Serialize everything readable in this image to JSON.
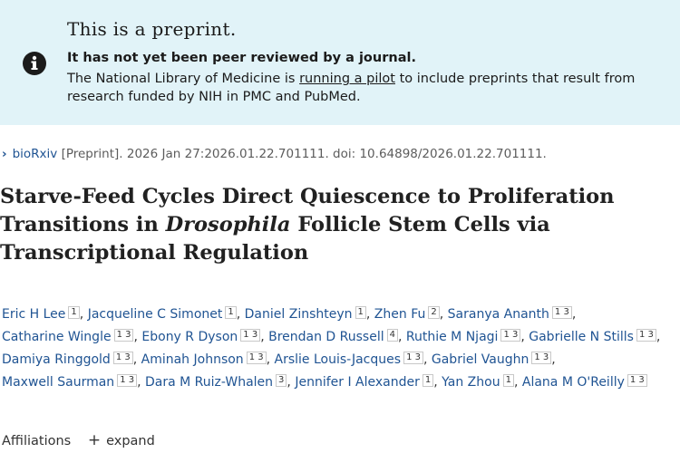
{
  "banner": {
    "title": "This is a preprint.",
    "line1": "It has not yet been peer reviewed by a journal.",
    "line2_before": "The National Library of Medicine is ",
    "line2_link": "running a pilot",
    "line2_after": " to include preprints that result from",
    "line3": "research funded by NIH in PMC and PubMed.",
    "icon": "info-icon"
  },
  "citation": {
    "journal": "bioRxiv",
    "text": " [Preprint]. 2026 Jan 27:2026.01.22.701111. doi: 10.64898/2026.01.22.701111."
  },
  "article": {
    "title_part1": "Starve-Feed Cycles Direct Quiescence to Proliferation Transitions in ",
    "title_italic": "Drosophila",
    "title_part2": " Follicle Stem Cells via Transcriptional Regulation"
  },
  "authors": [
    {
      "name": "Eric H Lee",
      "affs": "1"
    },
    {
      "name": "Jacqueline C Simonet",
      "affs": "1"
    },
    {
      "name": "Daniel Zinshteyn",
      "affs": "1"
    },
    {
      "name": "Zhen Fu",
      "affs": "2"
    },
    {
      "name": "Saranya Ananth",
      "affs": "1 3"
    },
    {
      "name": "Catharine Wingle",
      "affs": "1 3"
    },
    {
      "name": "Ebony R Dyson",
      "affs": "1 3"
    },
    {
      "name": "Brendan D Russell",
      "affs": "4"
    },
    {
      "name": "Ruthie M Njagi",
      "affs": "1 3"
    },
    {
      "name": "Gabrielle N Stills",
      "affs": "1 3"
    },
    {
      "name": "Damiya Ringgold",
      "affs": "1 3"
    },
    {
      "name": "Aminah Johnson",
      "affs": "1 3"
    },
    {
      "name": "Arslie Louis-Jacques",
      "affs": "1 3"
    },
    {
      "name": "Gabriel Vaughn",
      "affs": "1 3"
    },
    {
      "name": "Maxwell Saurman",
      "affs": "1 3"
    },
    {
      "name": "Dara M Ruiz-Whalen",
      "affs": "3"
    },
    {
      "name": "Jennifer I Alexander",
      "affs": "1"
    },
    {
      "name": "Yan Zhou",
      "affs": "1"
    },
    {
      "name": "Alana M O'Reilly",
      "affs": "1 3"
    }
  ],
  "affiliations": {
    "label": "Affiliations",
    "expand_label": "expand"
  },
  "colors": {
    "banner_bg": "#e1f3f8",
    "link": "#205493"
  }
}
